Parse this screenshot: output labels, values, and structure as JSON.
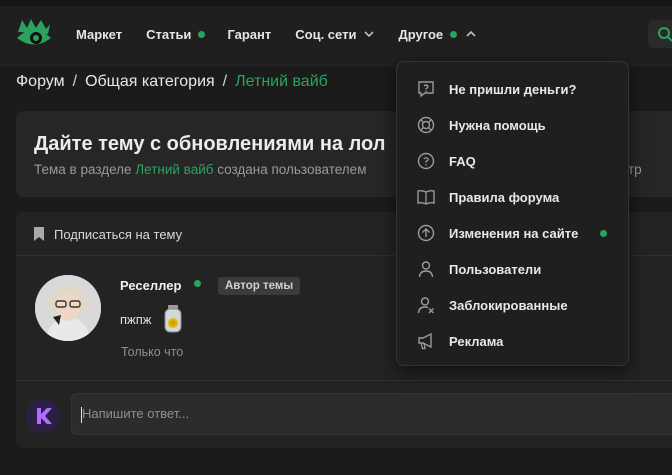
{
  "nav": {
    "items": [
      {
        "label": "Маркет",
        "dot": false,
        "chevron": false
      },
      {
        "label": "Статьи",
        "dot": true,
        "chevron": false
      },
      {
        "label": "Гарант",
        "dot": false,
        "chevron": false
      },
      {
        "label": "Соц. сети",
        "dot": false,
        "chevron": "down"
      },
      {
        "label": "Другое",
        "dot": true,
        "chevron": "up"
      }
    ]
  },
  "breadcrumb": {
    "items": [
      "Форум",
      "Общая категория",
      "Летний вайб"
    ],
    "separator": "/"
  },
  "thread": {
    "title": "Дайте тему с обновлениями на лол",
    "meta_prefix": "Тема в разделе ",
    "meta_section": "Летний вайб",
    "meta_suffix": " создана пользователем",
    "meta_tail": "тр"
  },
  "post": {
    "subscribe_label": "Подписаться на тему",
    "author": "Реселлер",
    "author_badge": "Автор темы",
    "text": "пжпж",
    "time": "Только что"
  },
  "reply": {
    "placeholder": "Напишите ответ..."
  },
  "dropdown": {
    "items": [
      {
        "label": "Не пришли деньги?",
        "icon": "question-bubble-icon",
        "dot": false
      },
      {
        "label": "Нужна помощь",
        "icon": "lifebuoy-icon",
        "dot": false
      },
      {
        "label": "FAQ",
        "icon": "question-circle-icon",
        "dot": false
      },
      {
        "label": "Правила форума",
        "icon": "book-icon",
        "dot": false
      },
      {
        "label": "Изменения на сайте",
        "icon": "arrow-up-circle-icon",
        "dot": true
      },
      {
        "label": "Пользователи",
        "icon": "user-icon",
        "dot": false
      },
      {
        "label": "Заблокированные",
        "icon": "user-blocked-icon",
        "dot": false
      },
      {
        "label": "Реклама",
        "icon": "megaphone-icon",
        "dot": false
      }
    ]
  },
  "colors": {
    "accent": "#2ba35e",
    "background": "#1b1b1b",
    "card": "#262626",
    "dropdown": "#1f1f1f"
  }
}
